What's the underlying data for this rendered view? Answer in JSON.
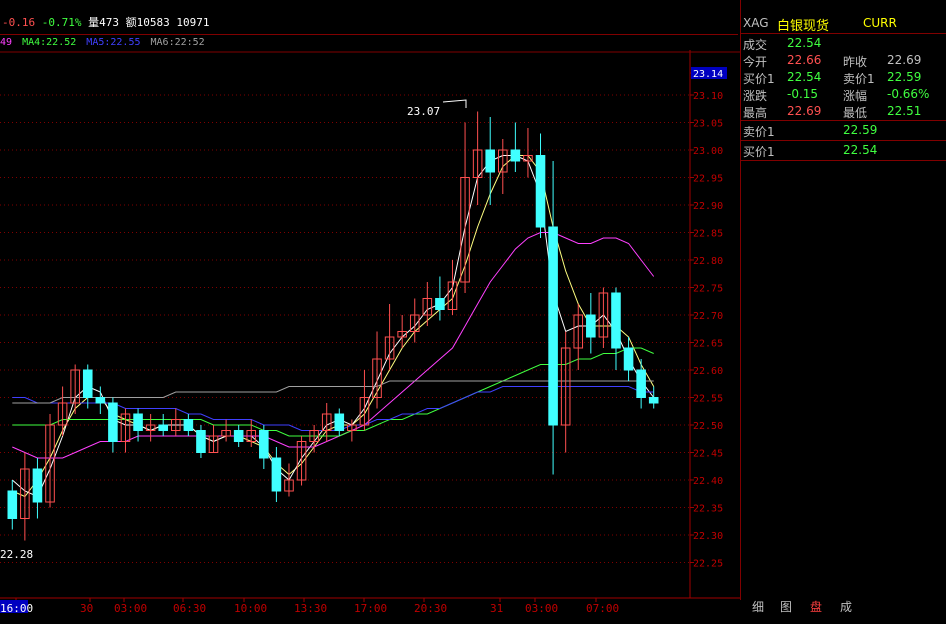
{
  "header": {
    "change": "-0.16",
    "change_pct": "-0.71%",
    "volume_label": "量473",
    "amount_label": "额10583",
    "extra": "10971"
  },
  "ma_row": {
    "ma3": "49",
    "ma4": "MA4:22.52",
    "ma5": "MA5:22.55",
    "ma6": "MA6:22:52"
  },
  "chart_data": {
    "type": "candlestick",
    "ylim": [
      22.2,
      23.16
    ],
    "y_ticks": [
      "23.14",
      "23.10",
      "23.05",
      "23.00",
      "22.95",
      "22.90",
      "22.85",
      "22.80",
      "22.75",
      "22.70",
      "22.65",
      "22.60",
      "22.55",
      "22.50",
      "22.45",
      "22.40",
      "22.35",
      "22.30",
      "22.25"
    ],
    "x_ticks": [
      "16:00",
      "30",
      "03:00",
      "06:30",
      "10:00",
      "13:30",
      "17:00",
      "20:30",
      "31",
      "03:00",
      "07:00"
    ],
    "high_annotation": "23.07",
    "low_annotation": "22.28",
    "last_price_label": "23.14",
    "candles": [
      [
        22.38,
        22.33,
        22.4,
        22.31
      ],
      [
        22.33,
        22.42,
        22.45,
        22.29
      ],
      [
        22.42,
        22.36,
        22.44,
        22.33
      ],
      [
        22.36,
        22.5,
        22.52,
        22.35
      ],
      [
        22.5,
        22.54,
        22.57,
        22.48
      ],
      [
        22.54,
        22.6,
        22.61,
        22.52
      ],
      [
        22.6,
        22.55,
        22.61,
        22.53
      ],
      [
        22.55,
        22.54,
        22.57,
        22.52
      ],
      [
        22.54,
        22.47,
        22.55,
        22.45
      ],
      [
        22.47,
        22.52,
        22.53,
        22.45
      ],
      [
        22.52,
        22.49,
        22.53,
        22.47
      ],
      [
        22.49,
        22.5,
        22.52,
        22.47
      ],
      [
        22.5,
        22.49,
        22.52,
        22.48
      ],
      [
        22.49,
        22.51,
        22.53,
        22.48
      ],
      [
        22.51,
        22.49,
        22.52,
        22.48
      ],
      [
        22.49,
        22.45,
        22.5,
        22.44
      ],
      [
        22.45,
        22.48,
        22.5,
        22.45
      ],
      [
        22.48,
        22.49,
        22.51,
        22.47
      ],
      [
        22.49,
        22.47,
        22.5,
        22.46
      ],
      [
        22.47,
        22.49,
        22.51,
        22.46
      ],
      [
        22.49,
        22.44,
        22.5,
        22.42
      ],
      [
        22.44,
        22.38,
        22.46,
        22.36
      ],
      [
        22.38,
        22.4,
        22.43,
        22.37
      ],
      [
        22.4,
        22.47,
        22.48,
        22.39
      ],
      [
        22.47,
        22.49,
        22.5,
        22.45
      ],
      [
        22.49,
        22.52,
        22.54,
        22.47
      ],
      [
        22.52,
        22.49,
        22.53,
        22.48
      ],
      [
        22.49,
        22.5,
        22.51,
        22.47
      ],
      [
        22.5,
        22.55,
        22.6,
        22.49
      ],
      [
        22.55,
        22.62,
        22.67,
        22.53
      ],
      [
        22.62,
        22.66,
        22.72,
        22.6
      ],
      [
        22.66,
        22.67,
        22.7,
        22.64
      ],
      [
        22.67,
        22.7,
        22.73,
        22.65
      ],
      [
        22.7,
        22.73,
        22.76,
        22.68
      ],
      [
        22.73,
        22.71,
        22.77,
        22.69
      ],
      [
        22.71,
        22.76,
        22.8,
        22.7
      ],
      [
        22.76,
        22.95,
        23.05,
        22.74
      ],
      [
        22.95,
        23.0,
        23.07,
        22.9
      ],
      [
        23.0,
        22.96,
        23.06,
        22.9
      ],
      [
        22.96,
        23.0,
        23.02,
        22.92
      ],
      [
        23.0,
        22.98,
        23.05,
        22.96
      ],
      [
        22.98,
        22.99,
        23.04,
        22.95
      ],
      [
        22.99,
        22.86,
        23.03,
        22.84
      ],
      [
        22.86,
        22.5,
        22.98,
        22.41
      ],
      [
        22.5,
        22.64,
        22.67,
        22.45
      ],
      [
        22.64,
        22.7,
        22.72,
        22.6
      ],
      [
        22.7,
        22.66,
        22.74,
        22.63
      ],
      [
        22.66,
        22.74,
        22.75,
        22.64
      ],
      [
        22.74,
        22.64,
        22.75,
        22.6
      ],
      [
        22.64,
        22.6,
        22.66,
        22.58
      ],
      [
        22.6,
        22.55,
        22.62,
        22.53
      ],
      [
        22.55,
        22.54,
        22.57,
        22.53
      ]
    ],
    "series": [
      {
        "color": "#ffff80",
        "values": [
          22.38,
          22.37,
          22.4,
          22.44,
          22.49,
          22.53,
          22.55,
          22.55,
          22.52,
          22.51,
          22.5,
          22.49,
          22.5,
          22.5,
          22.5,
          22.48,
          22.47,
          22.48,
          22.48,
          22.47,
          22.46,
          22.43,
          22.41,
          22.43,
          22.46,
          22.49,
          22.5,
          22.5,
          22.52,
          22.56,
          22.6,
          22.64,
          22.67,
          22.69,
          22.71,
          22.73,
          22.79,
          22.86,
          22.92,
          22.97,
          22.99,
          22.99,
          22.96,
          22.86,
          22.78,
          22.72,
          22.68,
          22.68,
          22.68,
          22.66,
          22.61,
          22.57
        ]
      },
      {
        "color": "#ffffff",
        "values": [
          22.4,
          22.38,
          22.37,
          22.42,
          22.48,
          22.55,
          22.57,
          22.56,
          22.51,
          22.5,
          22.5,
          22.49,
          22.5,
          22.5,
          22.5,
          22.48,
          22.47,
          22.48,
          22.48,
          22.48,
          22.46,
          22.42,
          22.4,
          22.44,
          22.47,
          22.5,
          22.51,
          22.5,
          22.53,
          22.58,
          22.63,
          22.66,
          22.68,
          22.71,
          22.72,
          22.75,
          22.86,
          22.95,
          22.98,
          22.99,
          22.99,
          22.98,
          22.92,
          22.74,
          22.67,
          22.68,
          22.68,
          22.7,
          22.67,
          22.62,
          22.58,
          22.55
        ]
      },
      {
        "color": "#ff40ff",
        "values": [
          22.46,
          22.45,
          22.44,
          22.44,
          22.44,
          22.45,
          22.46,
          22.47,
          22.47,
          22.47,
          22.48,
          22.48,
          22.48,
          22.48,
          22.48,
          22.48,
          22.48,
          22.48,
          22.48,
          22.48,
          22.48,
          22.47,
          22.46,
          22.46,
          22.46,
          22.47,
          22.48,
          22.49,
          22.5,
          22.52,
          22.54,
          22.56,
          22.58,
          22.6,
          22.62,
          22.64,
          22.68,
          22.72,
          22.76,
          22.79,
          22.82,
          22.84,
          22.85,
          22.85,
          22.84,
          22.83,
          22.83,
          22.84,
          22.84,
          22.83,
          22.8,
          22.77
        ]
      },
      {
        "color": "#40ff40",
        "values": [
          22.5,
          22.5,
          22.5,
          22.5,
          22.51,
          22.51,
          22.51,
          22.51,
          22.51,
          22.51,
          22.51,
          22.51,
          22.51,
          22.51,
          22.51,
          22.51,
          22.5,
          22.5,
          22.5,
          22.5,
          22.49,
          22.49,
          22.48,
          22.48,
          22.48,
          22.48,
          22.48,
          22.49,
          22.49,
          22.5,
          22.51,
          22.51,
          22.52,
          22.52,
          22.53,
          22.54,
          22.55,
          22.56,
          22.57,
          22.58,
          22.59,
          22.6,
          22.61,
          22.61,
          22.61,
          22.62,
          22.62,
          22.63,
          22.63,
          22.64,
          22.64,
          22.63
        ]
      },
      {
        "color": "#4040ff",
        "values": [
          22.55,
          22.55,
          22.54,
          22.54,
          22.54,
          22.54,
          22.54,
          22.54,
          22.54,
          22.53,
          22.53,
          22.53,
          22.53,
          22.53,
          22.52,
          22.52,
          22.51,
          22.51,
          22.51,
          22.51,
          22.5,
          22.5,
          22.5,
          22.49,
          22.49,
          22.49,
          22.49,
          22.5,
          22.5,
          22.51,
          22.51,
          22.52,
          22.52,
          22.53,
          22.53,
          22.54,
          22.55,
          22.56,
          22.56,
          22.57,
          22.57,
          22.57,
          22.57,
          22.57,
          22.57,
          22.57,
          22.57,
          22.57,
          22.57,
          22.57,
          22.56,
          22.56
        ]
      },
      {
        "color": "#a0a0a0",
        "values": [
          22.54,
          22.54,
          22.54,
          22.54,
          22.55,
          22.55,
          22.55,
          22.55,
          22.55,
          22.55,
          22.55,
          22.55,
          22.55,
          22.56,
          22.56,
          22.56,
          22.56,
          22.56,
          22.56,
          22.56,
          22.56,
          22.56,
          22.57,
          22.57,
          22.57,
          22.57,
          22.57,
          22.57,
          22.57,
          22.57,
          22.58,
          22.58,
          22.58,
          22.58,
          22.58,
          22.58,
          22.58,
          22.58,
          22.58,
          22.58,
          22.58,
          22.58,
          22.58,
          22.58,
          22.58,
          22.58,
          22.58,
          22.58,
          22.58,
          22.58,
          22.58,
          22.58
        ]
      }
    ]
  },
  "right_panel": {
    "symbol": "XAG",
    "name": "白银现货",
    "curr": "CURR",
    "rows": [
      {
        "l1": "成交",
        "v1": "22.54",
        "l2": "",
        "v2": ""
      },
      {
        "l1": "今开",
        "v1": "22.66",
        "l2": "昨收",
        "v2": "22.69"
      },
      {
        "l1": "买价1",
        "v1": "22.54",
        "l2": "卖价1",
        "v2": "22.59"
      },
      {
        "l1": "涨跌",
        "v1": "-0.15",
        "l2": "涨幅",
        "v2": "-0.66%"
      },
      {
        "l1": "最高",
        "v1": "22.69",
        "l2": "最低",
        "v2": "22.51"
      }
    ],
    "ask_label": "卖价1",
    "ask_value": "22.59",
    "bid_label": "买价1",
    "bid_value": "22.54"
  },
  "tabs": [
    "细",
    "图",
    "盘",
    "成"
  ]
}
